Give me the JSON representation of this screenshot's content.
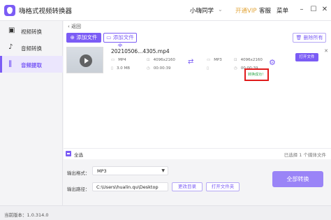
{
  "app": {
    "title": "嗨格式视频转换器"
  },
  "header": {
    "user_name": "小嗨同学",
    "vip_label": "开通VIP",
    "customer_service": "客服",
    "menu": "菜单",
    "minimize_icon": "minimize-icon",
    "maximize_icon": "maximize-icon",
    "close_icon": "close-icon"
  },
  "sidebar": {
    "items": [
      {
        "label": "视频转换",
        "icon": "video-convert-icon",
        "active": false
      },
      {
        "label": "音频转换",
        "icon": "audio-convert-icon",
        "active": false
      },
      {
        "label": "音频提取",
        "icon": "audio-extract-icon",
        "active": true
      }
    ]
  },
  "toolbar": {
    "back_label": "返回",
    "add_file": "添加文件",
    "add_folder": "添加文件夹",
    "delete_all": "删除所有"
  },
  "file": {
    "name": "20210506...4305.mp4",
    "source": {
      "format": "MP4",
      "resolution": "4096x2160",
      "size": "3.0 MB",
      "duration": "00:00:39"
    },
    "target": {
      "format": "MP3",
      "resolution": "4096x2160",
      "size": "",
      "duration": "00:00:39"
    },
    "open_label": "打开文件",
    "status": "转换成功！"
  },
  "selection": {
    "select_all": "全选",
    "count_text": "已选择 1 个媒体文件"
  },
  "output": {
    "format_label": "输出格式：",
    "format_value": "MP3",
    "path_label": "输出路径：",
    "path_value": "C:\\Users\\hualin.qu\\Desktop",
    "change_dir": "更改目录",
    "open_folder": "打开文件夹",
    "convert_all": "全部转换"
  },
  "status_bar": {
    "version": "当前版本：1.0.314.0"
  },
  "colors": {
    "accent": "#7b5cf5",
    "success": "#2fa84a",
    "highlight_border": "#e01b1b",
    "vip": "#e2a53a"
  }
}
